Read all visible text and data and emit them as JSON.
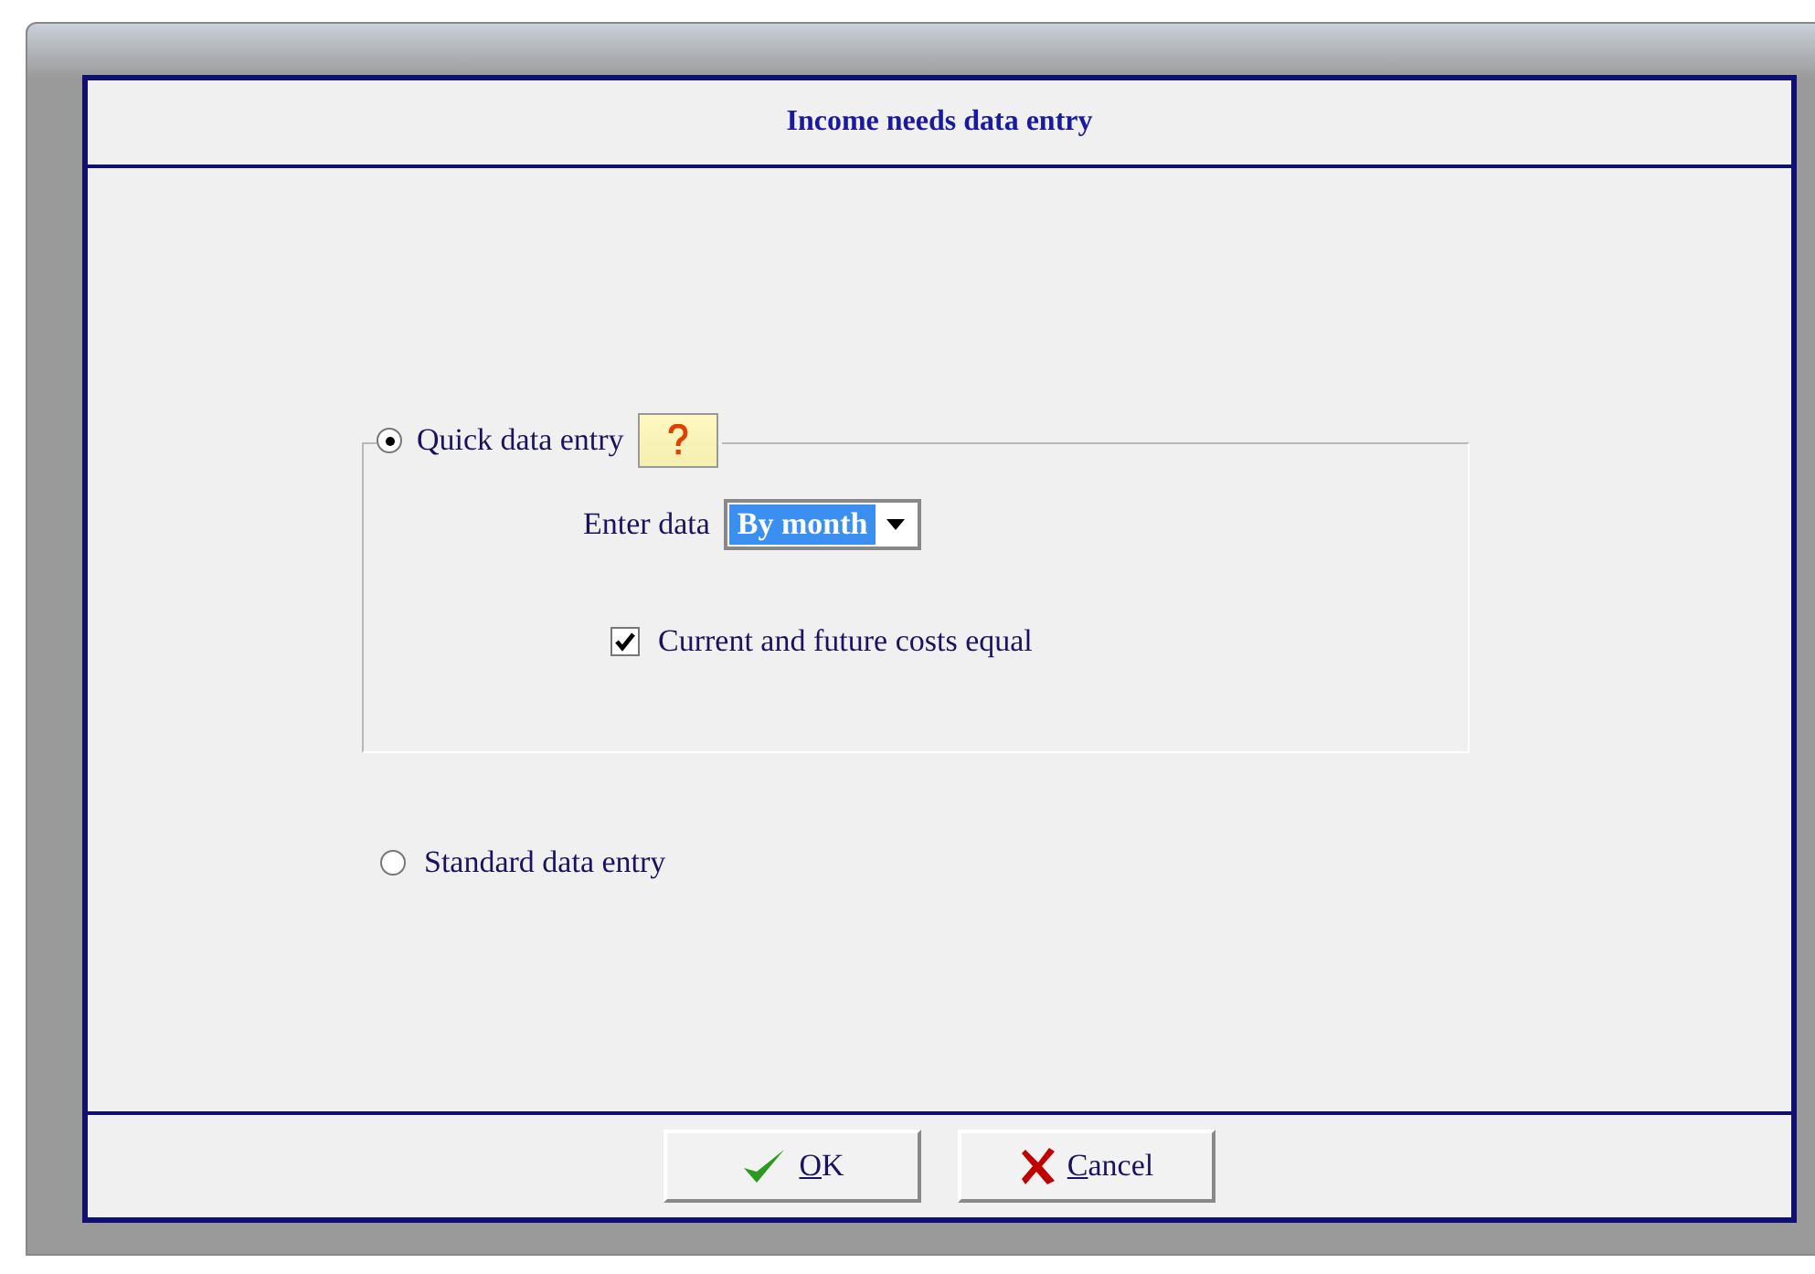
{
  "dialog": {
    "title": "Income needs data entry"
  },
  "options": [
    {
      "label": "Quick data entry",
      "selected": true
    },
    {
      "label": "Standard data entry",
      "selected": false
    }
  ],
  "enter_data": {
    "label": "Enter data",
    "value": "By month"
  },
  "checkbox": {
    "label": "Current and future costs equal",
    "checked": true
  },
  "buttons": [
    {
      "label": "OK",
      "kind": "ok"
    },
    {
      "label": "Cancel",
      "kind": "cancel"
    }
  ]
}
